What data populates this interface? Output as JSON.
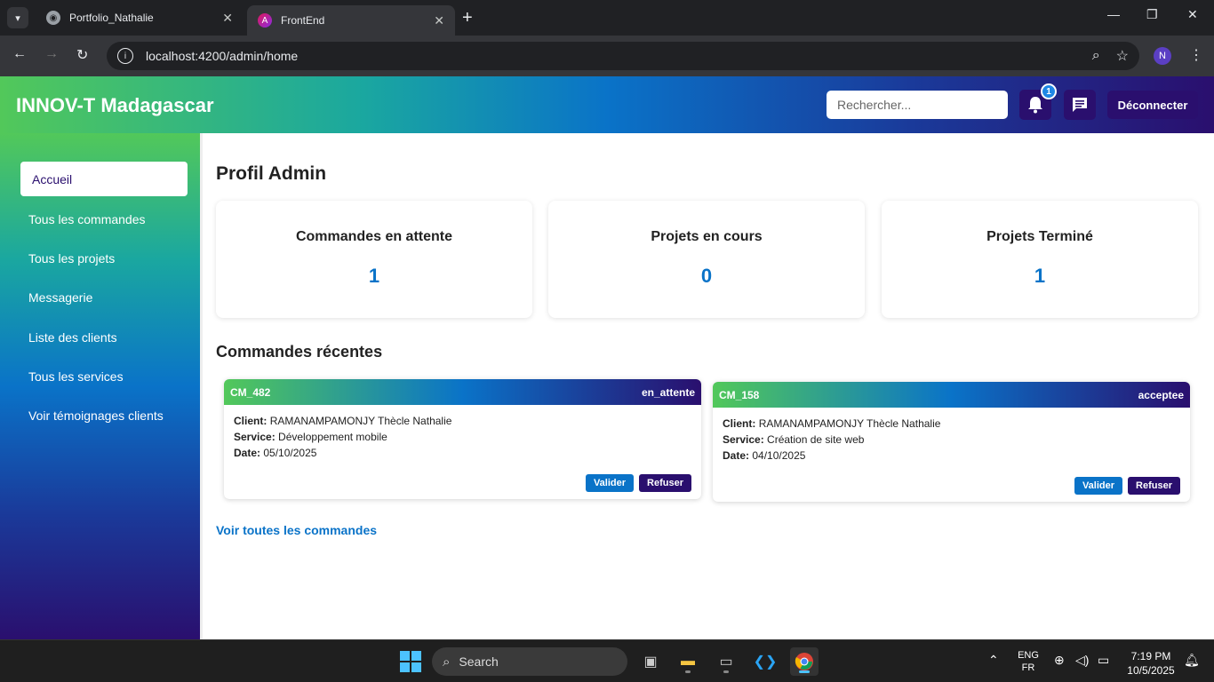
{
  "browser": {
    "tabs": [
      {
        "title": "Portfolio_Nathalie",
        "active": false
      },
      {
        "title": "FrontEnd",
        "active": true
      }
    ],
    "url": "localhost:4200/admin/home",
    "profile_initial": "N"
  },
  "header": {
    "brand": "INNOV-T Madagascar",
    "search_placeholder": "Rechercher...",
    "notification_count": "1",
    "logout_label": "Déconnecter"
  },
  "sidebar": {
    "items": [
      {
        "label": "Accueil",
        "active": true
      },
      {
        "label": "Tous les commandes"
      },
      {
        "label": "Tous les projets"
      },
      {
        "label": "Messagerie"
      },
      {
        "label": "Liste des clients"
      },
      {
        "label": "Tous les services"
      },
      {
        "label": "Voir témoignages clients"
      }
    ]
  },
  "main": {
    "title": "Profil Admin",
    "stats": [
      {
        "label": "Commandes en attente",
        "value": "1"
      },
      {
        "label": "Projets en cours",
        "value": "0"
      },
      {
        "label": "Projets Terminé",
        "value": "1"
      }
    ],
    "recent_title": "Commandes récentes",
    "orders": [
      {
        "code": "CM_482",
        "status": "en_attente",
        "client_label": "Client:",
        "client": "RAMANAMPAMONJY Thècle Nathalie",
        "service_label": "Service:",
        "service": "Développement mobile",
        "date_label": "Date:",
        "date": "05/10/2025",
        "validate": "Valider",
        "refuse": "Refuser"
      },
      {
        "code": "CM_158",
        "status": "acceptee",
        "client_label": "Client:",
        "client": "RAMANAMPAMONJY Thècle Nathalie",
        "service_label": "Service:",
        "service": "Création de site web",
        "date_label": "Date:",
        "date": "04/10/2025",
        "validate": "Valider",
        "refuse": "Refuser"
      }
    ],
    "see_all": "Voir toutes les commandes"
  },
  "taskbar": {
    "search_label": "Search",
    "lang_top": "ENG",
    "lang_bottom": "FR",
    "time": "7:19 PM",
    "date": "10/5/2025"
  },
  "colors": {
    "accent_blue": "#0a73c8",
    "accent_purple": "#2a0f6e",
    "accent_green": "#52c85a"
  }
}
